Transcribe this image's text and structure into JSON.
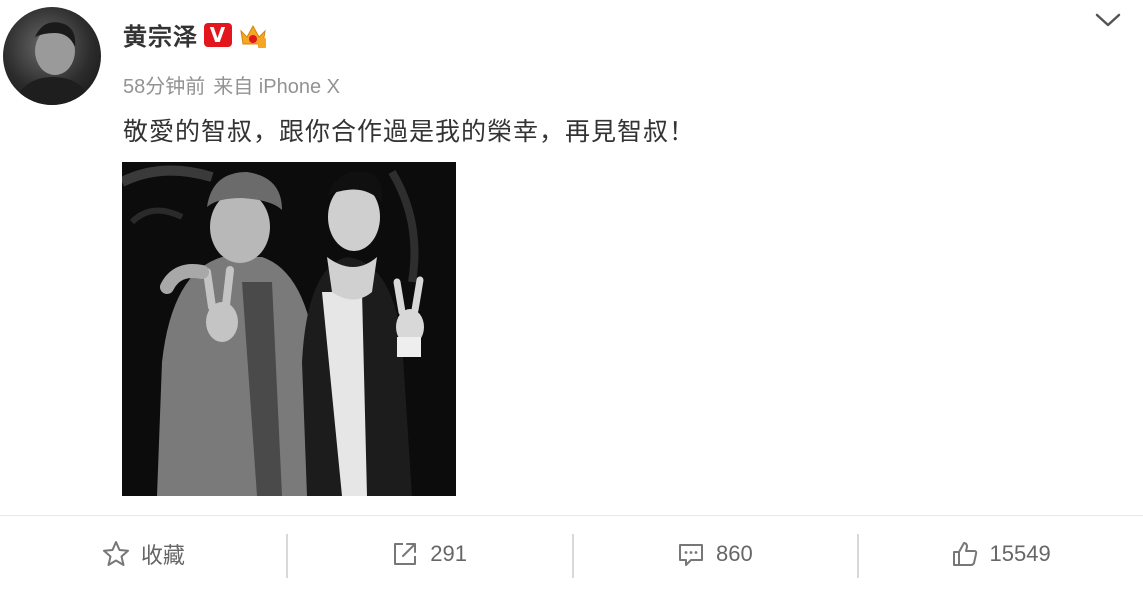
{
  "post": {
    "author": "黄宗泽",
    "verified_badge": "V",
    "time": "58分钟前",
    "source": "来自 iPhone X",
    "text": "敬愛的智叔，跟你合作過是我的榮幸，再見智叔！"
  },
  "actions": {
    "favorite_label": "收藏",
    "repost_count": "291",
    "comment_count": "860",
    "like_count": "15549"
  },
  "colors": {
    "verified_badge": "#e2161c",
    "meta_text": "#939393",
    "action_text": "#666666",
    "crown": "#f5a623"
  },
  "icons": [
    "chevron-down-icon",
    "verified-icon",
    "crown-icon",
    "star-icon",
    "share-icon",
    "comment-icon",
    "thumbs-up-icon"
  ]
}
